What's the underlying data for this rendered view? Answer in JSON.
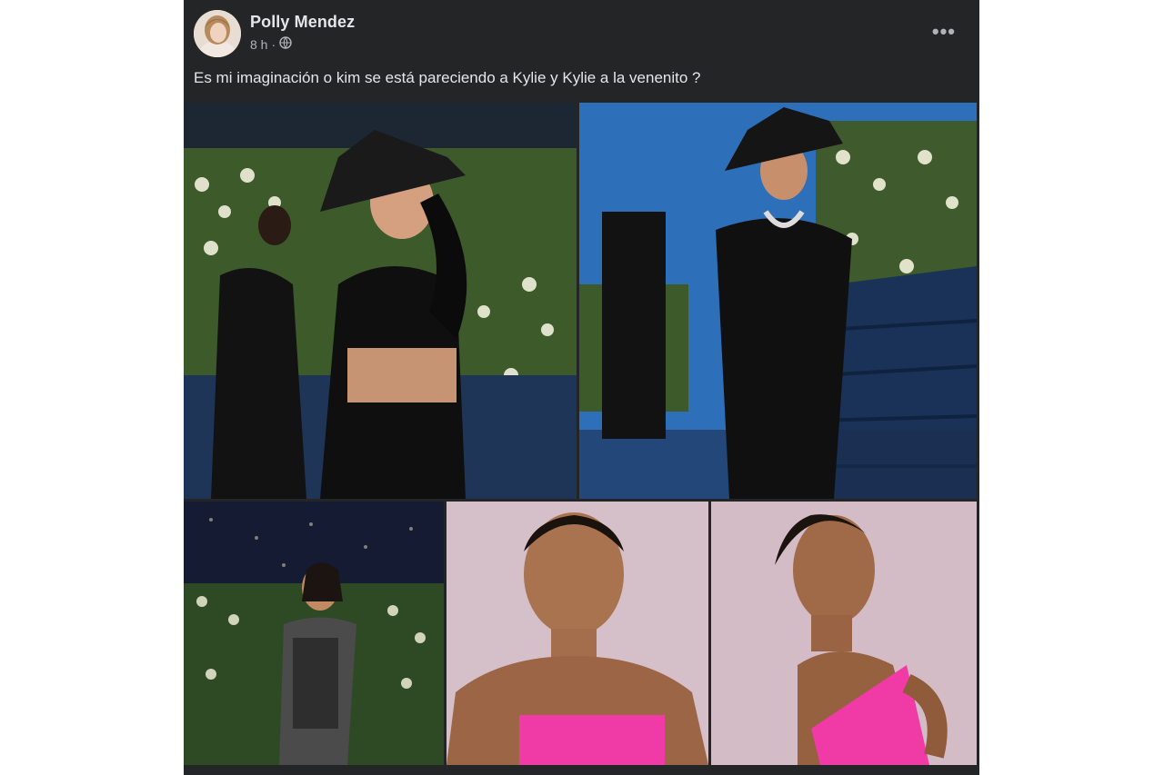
{
  "post": {
    "author": "Polly Mendez",
    "time": "8 h",
    "separator": "·",
    "privacy_icon": "globe-icon",
    "more_icon": "more-options-icon",
    "more_label": "•••",
    "caption": "Es mi imaginación o kim se está pareciendo a Kylie y Kylie a la venenito ?"
  },
  "photos": [
    {
      "subject": "woman in black leather hat and outfit, back view"
    },
    {
      "subject": "woman in black leather hat and dress on stairs"
    },
    {
      "subject": "woman in sheer black dress among flowers"
    },
    {
      "subject": "person in pink strapless top, front view"
    },
    {
      "subject": "person in pink strapless top, side view"
    }
  ],
  "colors": {
    "post_bg": "#242526",
    "text_primary": "#e4e6eb",
    "text_secondary": "#b0b3b8",
    "pink": "#ff4fb0"
  }
}
